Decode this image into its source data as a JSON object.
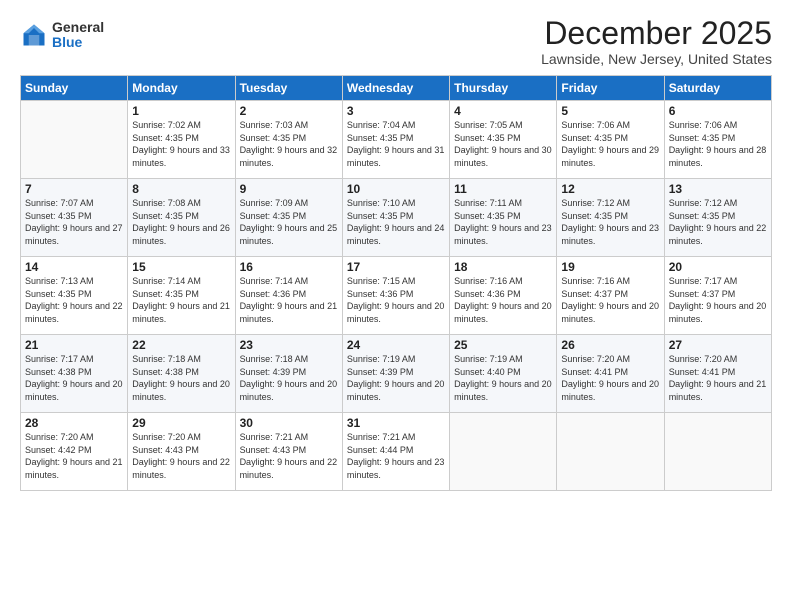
{
  "logo": {
    "general": "General",
    "blue": "Blue"
  },
  "title": "December 2025",
  "location": "Lawnside, New Jersey, United States",
  "days_header": [
    "Sunday",
    "Monday",
    "Tuesday",
    "Wednesday",
    "Thursday",
    "Friday",
    "Saturday"
  ],
  "weeks": [
    [
      {
        "day": "",
        "sunrise": "",
        "sunset": "",
        "daylight": ""
      },
      {
        "day": "1",
        "sunrise": "Sunrise: 7:02 AM",
        "sunset": "Sunset: 4:35 PM",
        "daylight": "Daylight: 9 hours and 33 minutes."
      },
      {
        "day": "2",
        "sunrise": "Sunrise: 7:03 AM",
        "sunset": "Sunset: 4:35 PM",
        "daylight": "Daylight: 9 hours and 32 minutes."
      },
      {
        "day": "3",
        "sunrise": "Sunrise: 7:04 AM",
        "sunset": "Sunset: 4:35 PM",
        "daylight": "Daylight: 9 hours and 31 minutes."
      },
      {
        "day": "4",
        "sunrise": "Sunrise: 7:05 AM",
        "sunset": "Sunset: 4:35 PM",
        "daylight": "Daylight: 9 hours and 30 minutes."
      },
      {
        "day": "5",
        "sunrise": "Sunrise: 7:06 AM",
        "sunset": "Sunset: 4:35 PM",
        "daylight": "Daylight: 9 hours and 29 minutes."
      },
      {
        "day": "6",
        "sunrise": "Sunrise: 7:06 AM",
        "sunset": "Sunset: 4:35 PM",
        "daylight": "Daylight: 9 hours and 28 minutes."
      }
    ],
    [
      {
        "day": "7",
        "sunrise": "Sunrise: 7:07 AM",
        "sunset": "Sunset: 4:35 PM",
        "daylight": "Daylight: 9 hours and 27 minutes."
      },
      {
        "day": "8",
        "sunrise": "Sunrise: 7:08 AM",
        "sunset": "Sunset: 4:35 PM",
        "daylight": "Daylight: 9 hours and 26 minutes."
      },
      {
        "day": "9",
        "sunrise": "Sunrise: 7:09 AM",
        "sunset": "Sunset: 4:35 PM",
        "daylight": "Daylight: 9 hours and 25 minutes."
      },
      {
        "day": "10",
        "sunrise": "Sunrise: 7:10 AM",
        "sunset": "Sunset: 4:35 PM",
        "daylight": "Daylight: 9 hours and 24 minutes."
      },
      {
        "day": "11",
        "sunrise": "Sunrise: 7:11 AM",
        "sunset": "Sunset: 4:35 PM",
        "daylight": "Daylight: 9 hours and 23 minutes."
      },
      {
        "day": "12",
        "sunrise": "Sunrise: 7:12 AM",
        "sunset": "Sunset: 4:35 PM",
        "daylight": "Daylight: 9 hours and 23 minutes."
      },
      {
        "day": "13",
        "sunrise": "Sunrise: 7:12 AM",
        "sunset": "Sunset: 4:35 PM",
        "daylight": "Daylight: 9 hours and 22 minutes."
      }
    ],
    [
      {
        "day": "14",
        "sunrise": "Sunrise: 7:13 AM",
        "sunset": "Sunset: 4:35 PM",
        "daylight": "Daylight: 9 hours and 22 minutes."
      },
      {
        "day": "15",
        "sunrise": "Sunrise: 7:14 AM",
        "sunset": "Sunset: 4:35 PM",
        "daylight": "Daylight: 9 hours and 21 minutes."
      },
      {
        "day": "16",
        "sunrise": "Sunrise: 7:14 AM",
        "sunset": "Sunset: 4:36 PM",
        "daylight": "Daylight: 9 hours and 21 minutes."
      },
      {
        "day": "17",
        "sunrise": "Sunrise: 7:15 AM",
        "sunset": "Sunset: 4:36 PM",
        "daylight": "Daylight: 9 hours and 20 minutes."
      },
      {
        "day": "18",
        "sunrise": "Sunrise: 7:16 AM",
        "sunset": "Sunset: 4:36 PM",
        "daylight": "Daylight: 9 hours and 20 minutes."
      },
      {
        "day": "19",
        "sunrise": "Sunrise: 7:16 AM",
        "sunset": "Sunset: 4:37 PM",
        "daylight": "Daylight: 9 hours and 20 minutes."
      },
      {
        "day": "20",
        "sunrise": "Sunrise: 7:17 AM",
        "sunset": "Sunset: 4:37 PM",
        "daylight": "Daylight: 9 hours and 20 minutes."
      }
    ],
    [
      {
        "day": "21",
        "sunrise": "Sunrise: 7:17 AM",
        "sunset": "Sunset: 4:38 PM",
        "daylight": "Daylight: 9 hours and 20 minutes."
      },
      {
        "day": "22",
        "sunrise": "Sunrise: 7:18 AM",
        "sunset": "Sunset: 4:38 PM",
        "daylight": "Daylight: 9 hours and 20 minutes."
      },
      {
        "day": "23",
        "sunrise": "Sunrise: 7:18 AM",
        "sunset": "Sunset: 4:39 PM",
        "daylight": "Daylight: 9 hours and 20 minutes."
      },
      {
        "day": "24",
        "sunrise": "Sunrise: 7:19 AM",
        "sunset": "Sunset: 4:39 PM",
        "daylight": "Daylight: 9 hours and 20 minutes."
      },
      {
        "day": "25",
        "sunrise": "Sunrise: 7:19 AM",
        "sunset": "Sunset: 4:40 PM",
        "daylight": "Daylight: 9 hours and 20 minutes."
      },
      {
        "day": "26",
        "sunrise": "Sunrise: 7:20 AM",
        "sunset": "Sunset: 4:41 PM",
        "daylight": "Daylight: 9 hours and 20 minutes."
      },
      {
        "day": "27",
        "sunrise": "Sunrise: 7:20 AM",
        "sunset": "Sunset: 4:41 PM",
        "daylight": "Daylight: 9 hours and 21 minutes."
      }
    ],
    [
      {
        "day": "28",
        "sunrise": "Sunrise: 7:20 AM",
        "sunset": "Sunset: 4:42 PM",
        "daylight": "Daylight: 9 hours and 21 minutes."
      },
      {
        "day": "29",
        "sunrise": "Sunrise: 7:20 AM",
        "sunset": "Sunset: 4:43 PM",
        "daylight": "Daylight: 9 hours and 22 minutes."
      },
      {
        "day": "30",
        "sunrise": "Sunrise: 7:21 AM",
        "sunset": "Sunset: 4:43 PM",
        "daylight": "Daylight: 9 hours and 22 minutes."
      },
      {
        "day": "31",
        "sunrise": "Sunrise: 7:21 AM",
        "sunset": "Sunset: 4:44 PM",
        "daylight": "Daylight: 9 hours and 23 minutes."
      },
      {
        "day": "",
        "sunrise": "",
        "sunset": "",
        "daylight": ""
      },
      {
        "day": "",
        "sunrise": "",
        "sunset": "",
        "daylight": ""
      },
      {
        "day": "",
        "sunrise": "",
        "sunset": "",
        "daylight": ""
      }
    ]
  ]
}
